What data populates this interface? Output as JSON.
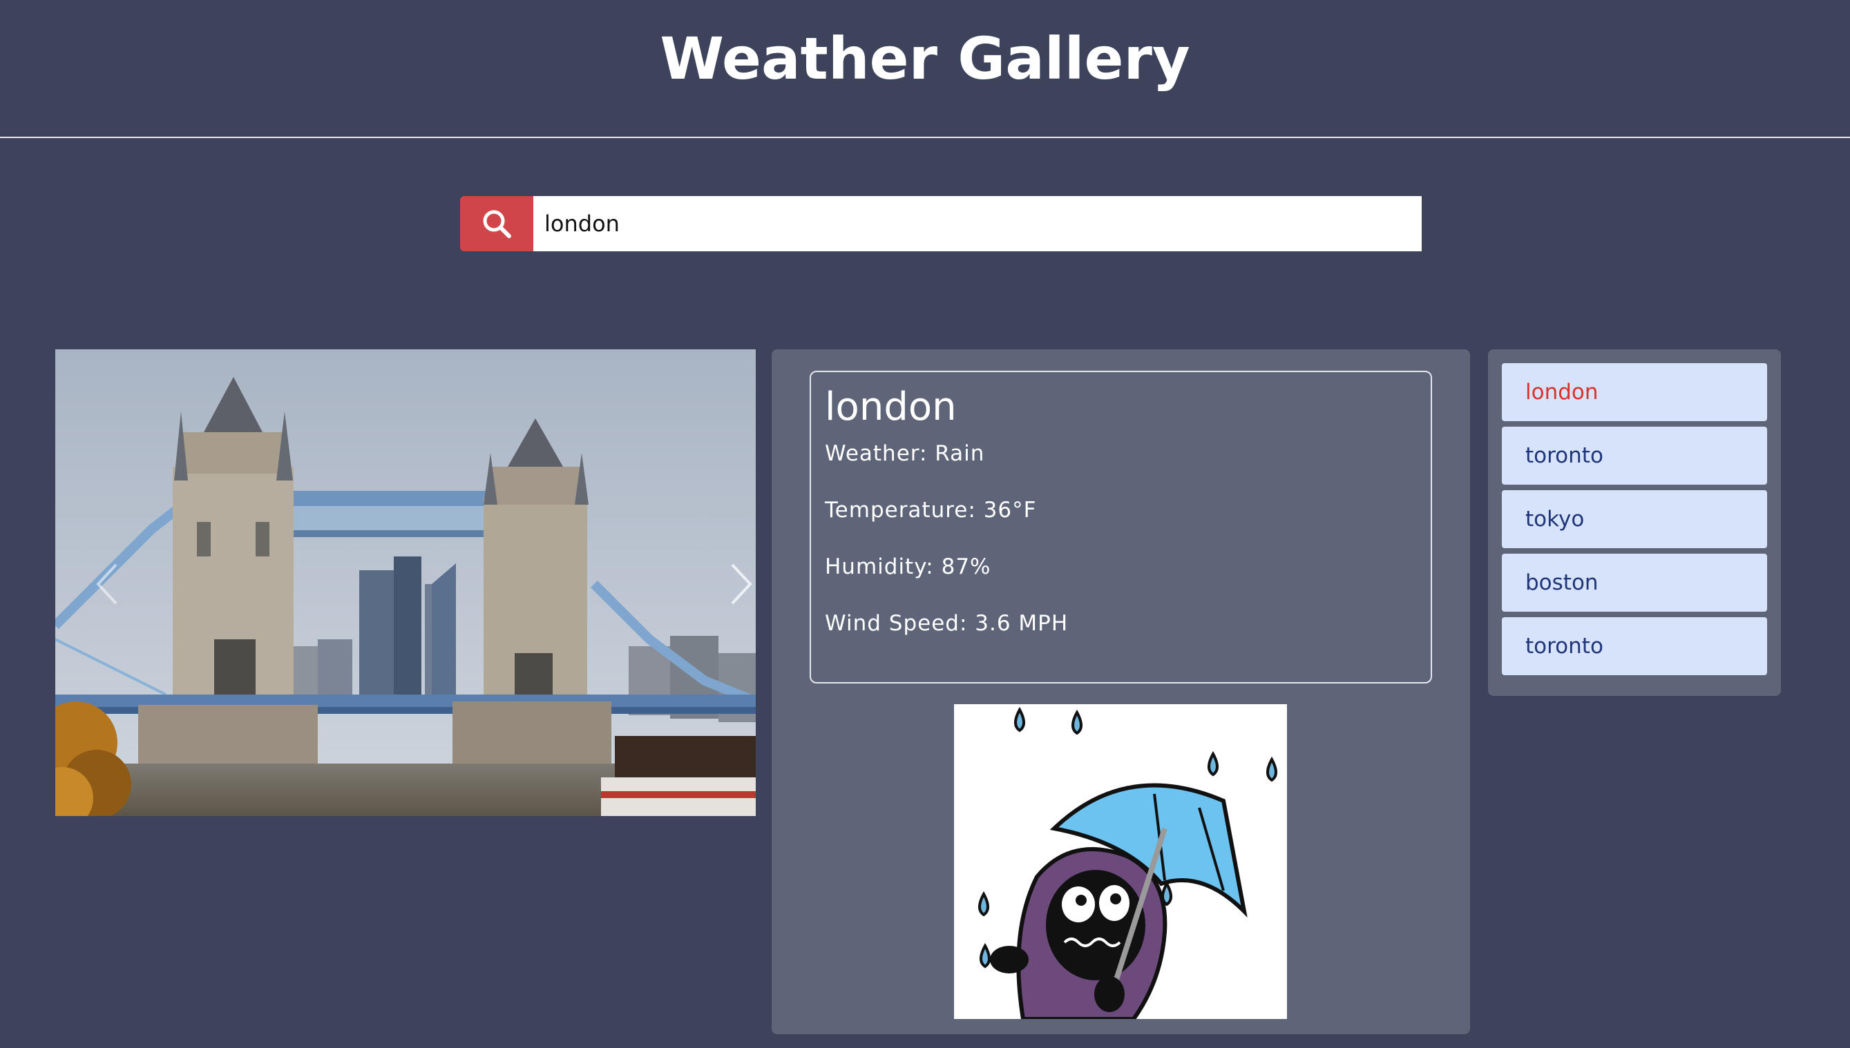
{
  "header": {
    "title": "Weather Gallery"
  },
  "search": {
    "value": "london",
    "button_icon": "search-icon"
  },
  "carousel": {
    "image_alt": "Tower Bridge, London",
    "prev_icon": "chevron-left-icon",
    "next_icon": "chevron-right-icon"
  },
  "weather": {
    "city": "london",
    "condition": "Weather: Rain",
    "temperature": "Temperature: 36°F",
    "humidity": "Humidity: 87%",
    "wind": "Wind Speed: 3.6 MPH",
    "icon": "rain-umbrella-character-icon"
  },
  "history": {
    "items": [
      {
        "label": "london",
        "active": true
      },
      {
        "label": "toronto",
        "active": false
      },
      {
        "label": "tokyo",
        "active": false
      },
      {
        "label": "boston",
        "active": false
      },
      {
        "label": "toronto",
        "active": false
      }
    ]
  },
  "colors": {
    "background": "#3c435b",
    "panel": "#5f6579",
    "search_button": "#d0454a",
    "history_item": "#d6e3fb",
    "history_text": "#1f3577",
    "history_active": "#d9322a"
  }
}
